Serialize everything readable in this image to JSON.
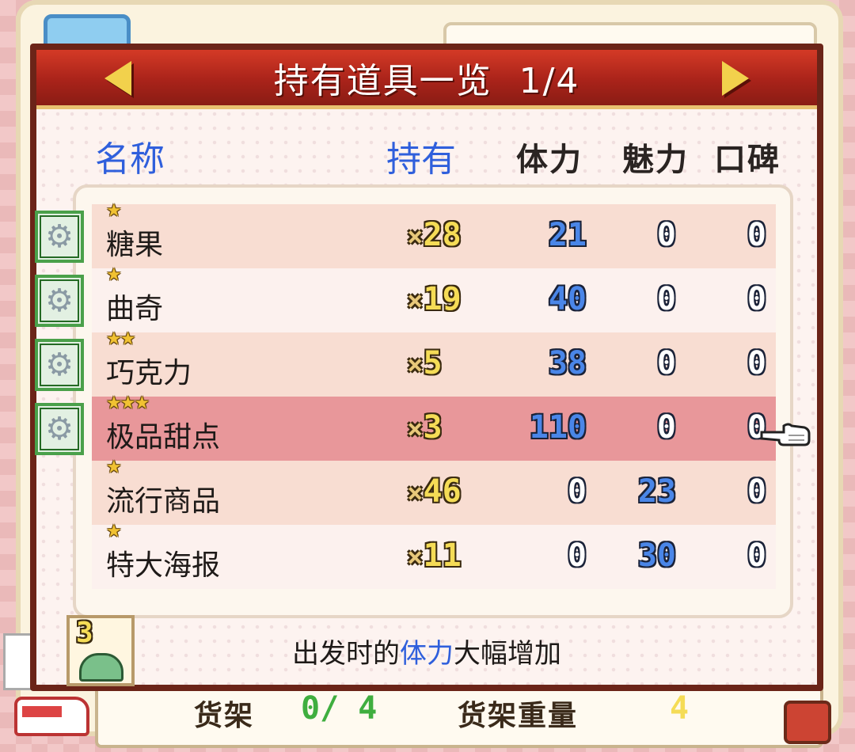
{
  "dialog": {
    "title": "持有道具一览",
    "page": "1/4"
  },
  "headers": {
    "name": "名称",
    "owned": "持有",
    "stamina": "体力",
    "charm": "魅力",
    "reputation": "口碑"
  },
  "items": [
    {
      "stars": "★",
      "name": "糖果",
      "qty_prefix": "×",
      "qty": "28",
      "stamina": "21",
      "charm": "0",
      "reputation": "0",
      "has_gear": true
    },
    {
      "stars": "★",
      "name": "曲奇",
      "qty_prefix": "×",
      "qty": "19",
      "stamina": "40",
      "charm": "0",
      "reputation": "0",
      "has_gear": true
    },
    {
      "stars": "★★",
      "name": "巧克力",
      "qty_prefix": "×",
      "qty": "5",
      "stamina": "38",
      "charm": "0",
      "reputation": "0",
      "has_gear": true
    },
    {
      "stars": "★★★",
      "name": "极品甜点",
      "qty_prefix": "×",
      "qty": "3",
      "stamina": "110",
      "charm": "0",
      "reputation": "0",
      "has_gear": true,
      "selected": true
    },
    {
      "stars": "★",
      "name": "流行商品",
      "qty_prefix": "×",
      "qty": "46",
      "stamina": "0",
      "charm": "23",
      "reputation": "0",
      "has_gear": false
    },
    {
      "stars": "★",
      "name": "特大海报",
      "qty_prefix": "×",
      "qty": "11",
      "stamina": "0",
      "charm": "30",
      "reputation": "0",
      "has_gear": false
    }
  ],
  "description": {
    "before": "出发时的",
    "highlight": "体力",
    "after": "大幅增加"
  },
  "weight_badge": "3",
  "status_bar": {
    "shelf_label": "货架",
    "shelf_value": "0/ 4",
    "weight_label": "货架重量",
    "weight_value": "4"
  },
  "colors": {
    "title_bar": "#a9231a",
    "header_blue": "#2f5fdc",
    "selected_row": "#e8979a",
    "qty_yellow": "#f5dc56"
  },
  "icons": {
    "prev": "left-arrow-icon",
    "next": "right-arrow-icon",
    "gear": "gear-icon",
    "pointer": "pointing-hand-icon"
  }
}
